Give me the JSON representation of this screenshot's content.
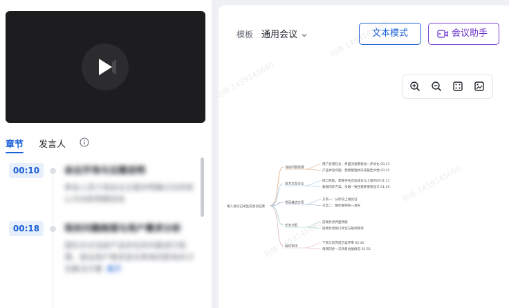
{
  "video": {
    "play_icon": "play-icon"
  },
  "tabs": [
    {
      "label": "章节",
      "active": true
    },
    {
      "label": "发言人",
      "active": false
    }
  ],
  "chapters": [
    {
      "time": "00:10",
      "title": "会议开场与议题说明",
      "summary": "参会人员介绍会议主题并明确讨论的核心方向和预期目标",
      "more": ""
    },
    {
      "time": "00:18",
      "title": "现状问题梳理与用户需求分析",
      "summary": "团队针对当前产品存在的问题进行梳理，提出用户需求变化带来的影响并讨论解决方案",
      "more": "展开"
    }
  ],
  "header": {
    "template_label": "模板",
    "template_value": "通用会议",
    "text_mode_button": "文本模式",
    "assistant_button": "会议助手"
  },
  "colors": {
    "accent": "#1a5fd6",
    "assistant": "#6a32c9"
  },
  "watermark": "刘伟 1459145660",
  "mindmap": {
    "root": "输入会议记录生成会议纪要",
    "branches": [
      {
        "label": "当前问题梳理",
        "color": "#e0a97a",
        "children": [
          "用户反馈较多，界面流程需要进一步优化 00:21",
          "产品体验问题，需要整理并形成报告文档 00:35"
        ]
      },
      {
        "label": "技术方案讨论",
        "color": "#a0c4e8",
        "children": [
          "接口性能，需要评估改造成本与上线时间 01:12",
          "数据同步方案，多端一致性需要重新设计 01:30"
        ]
      },
      {
        "label": "项目推进方案",
        "color": "#9fb0e0",
        "children": [
          "方案一：分阶段上线验证",
          "方案二：整体重构统一发布"
        ]
      },
      {
        "label": "任务分配",
        "color": "#9fd6b8",
        "children": [
          "前端负责界面改版",
          "后端负责接口优化与联调测试"
        ]
      },
      {
        "label": "后续安排",
        "color": "#e3b0c8",
        "children": [
          "下周三前完成方案评审 02:40",
          "每周同步一次项目进展情况 02:55"
        ]
      }
    ]
  }
}
